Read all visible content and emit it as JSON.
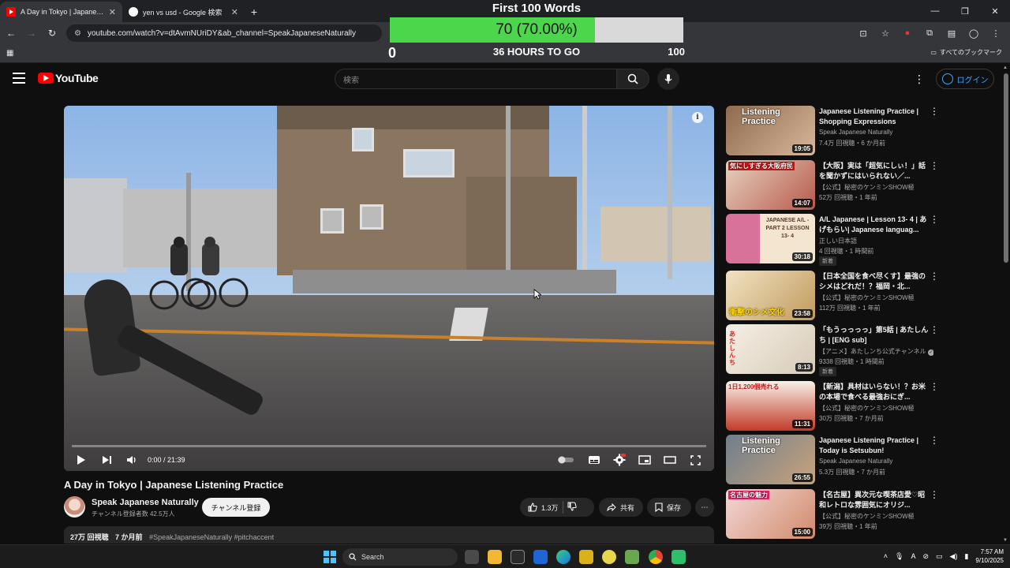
{
  "browser": {
    "tabs": [
      {
        "title": "A Day in Tokyo | Japanese Liste",
        "active": true,
        "icon": "youtube-favicon"
      },
      {
        "title": "yen vs usd - Google 検索",
        "active": false,
        "icon": "google-favicon"
      }
    ],
    "url": "youtube.com/watch?v=dtAvmNUriDY&ab_channel=SpeakJapaneseNaturally",
    "all_bookmarks": "すべてのブックマーク"
  },
  "overlay": {
    "title": "First 100 Words",
    "progress_label": "70 (70.00%)",
    "progress_fraction": 0.7,
    "min": "0",
    "middle": "36 HOURS TO GO",
    "max": "100",
    "fill_color": "#4cd64c"
  },
  "youtube": {
    "logo_text": "YouTube",
    "search_placeholder": "検索",
    "login_label": "ログイン",
    "brand_color": "#ff0000"
  },
  "player": {
    "time": "0:00 / 21:39"
  },
  "video": {
    "title": "A Day in Tokyo | Japanese Listening Practice",
    "channel": "Speak Japanese Naturally",
    "subscribers": "チャンネル登録者数 42.5万人",
    "subscribe_label": "チャンネル登録",
    "likes": "1.3万",
    "share_label": "共有",
    "save_label": "保存",
    "views": "27万 回視聴",
    "age": "7 か月前",
    "hashtags": "#SpeakJapaneseNaturally #pitchaccent"
  },
  "recommendations": [
    {
      "title": "Japanese Listening Practice | Shopping Expressions",
      "channel": "Speak Japanese Naturally",
      "meta": "7.4万 回視聴・6 か月前",
      "duration": "19:05",
      "badge": "",
      "thumb_text": "Listening Practice"
    },
    {
      "title": "【大阪】実は「超気にしぃ！」話を聞かずにはいられない／...",
      "channel": "【公式】秘密のケンミンSHOW極",
      "meta": "52万 回視聴・1 年前",
      "duration": "14:07",
      "badge": "",
      "thumb_text": "気にしすぎる大阪府民"
    },
    {
      "title": "A/L Japanese | Lesson 13- 4 | あげもらい| Japanese languag...",
      "channel": "正しい日本語",
      "meta": "4 回視聴・1 時間前",
      "duration": "30:18",
      "badge": "新着",
      "thumb_text": "JAPANESE A/L - PART 2 LESSON 13- 4"
    },
    {
      "title": "【日本全国を食べ尽くす】最強のシメはどれだ！？福岡・北...",
      "channel": "【公式】秘密のケンミンSHOW極",
      "meta": "112万 回視聴・1 年前",
      "duration": "23:58",
      "badge": "",
      "thumb_text": "衝撃のシメ文化"
    },
    {
      "title": "「もうっっっっ」第5話 | あたしんち | [ENG sub]",
      "channel": "【アニメ】あたしンち公式チャンネル",
      "meta": "9338 回視聴・1 時間前",
      "duration": "8:13",
      "badge": "新着",
      "thumb_text": "あたしんち"
    },
    {
      "title": "【新潟】具材はいらない！？お米の本場で食べる最強おにぎ...",
      "channel": "【公式】秘密のケンミンSHOW極",
      "meta": "30万 回視聴・7 か月前",
      "duration": "11:31",
      "badge": "",
      "thumb_text": "1日1,200個売れる"
    },
    {
      "title": "Japanese Listening Practice | Today is Setsubun!",
      "channel": "Speak Japanese Naturally",
      "meta": "5.3万 回視聴・7 か月前",
      "duration": "26:55",
      "badge": "",
      "thumb_text": "Listening Practice"
    },
    {
      "title": "【名古屋】異次元な喫茶店愛♡昭和レトロな雰囲気にオリジ...",
      "channel": "【公式】秘密のケンミンSHOW極",
      "meta": "39万 回視聴・1 年前",
      "duration": "15:00",
      "badge": "",
      "thumb_text": "名古屋の魅力"
    }
  ],
  "taskbar": {
    "search_label": "Search",
    "time": "7:57 AM",
    "date": "9/10/2025",
    "ime": "A"
  }
}
